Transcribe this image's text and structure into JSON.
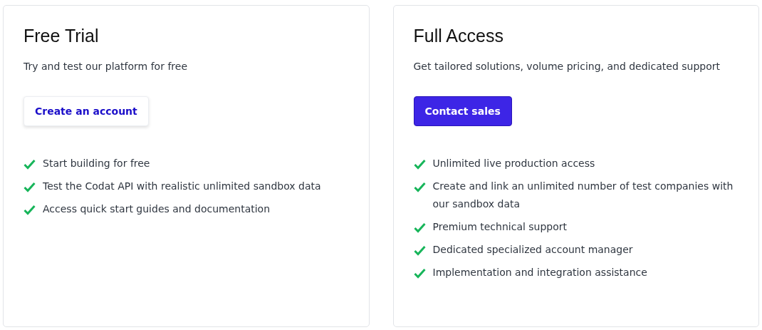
{
  "plans": [
    {
      "title": "Free Trial",
      "subtitle": "Try and test our platform for free",
      "button": {
        "label": "Create an account",
        "kind": "outline"
      },
      "features": [
        "Start building for free",
        "Test the Codat API with realistic unlimited sandbox data",
        "Access quick start guides and documentation"
      ]
    },
    {
      "title": "Full Access",
      "subtitle": "Get tailored solutions, volume pricing, and dedicated support",
      "button": {
        "label": "Contact sales",
        "kind": "filled"
      },
      "features": [
        "Unlimited live production access",
        "Create and link an unlimited number of test companies with our sandbox data",
        "Premium technical support",
        "Dedicated specialized account manager",
        "Implementation and integration assistance"
      ]
    }
  ]
}
